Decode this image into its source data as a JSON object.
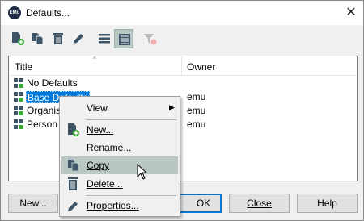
{
  "window": {
    "app_icon_text": "EMu",
    "title": "Defaults...",
    "close_glyph": "✕"
  },
  "toolbar": {
    "buttons": [
      {
        "name": "new-default-icon"
      },
      {
        "name": "copy-default-icon"
      },
      {
        "name": "delete-icon"
      },
      {
        "name": "edit-pencil-icon"
      },
      {
        "name": "list-view-icon"
      },
      {
        "name": "details-view-icon",
        "active": true
      },
      {
        "name": "clear-filter-icon",
        "disabled": true
      }
    ]
  },
  "list": {
    "columns": {
      "title": "Title",
      "owner": "Owner"
    },
    "sort_glyph": "^",
    "rows": [
      {
        "title": "No Defaults",
        "owner": ""
      },
      {
        "title": "Base Defaults",
        "owner": "emu",
        "selected": true
      },
      {
        "title": "Organisat",
        "owner": "emu"
      },
      {
        "title": "Person P",
        "owner": "emu"
      }
    ]
  },
  "buttons": {
    "new": "New...",
    "ok": "OK",
    "close": "Close",
    "help": "Help"
  },
  "context_menu": {
    "items": [
      {
        "label": "View",
        "submenu": true,
        "submenu_glyph": "▶"
      },
      {
        "label": "New...",
        "icon": "new-document-icon"
      },
      {
        "label": "Rename..."
      },
      {
        "label": "Copy",
        "icon": "copy-icon",
        "highlighted": true
      },
      {
        "label": "Delete...",
        "icon": "trash-icon"
      },
      {
        "label": "Properties...",
        "icon": "pencil-icon"
      }
    ]
  },
  "colors": {
    "selection": "#0078d7",
    "menu_highlight": "#b9c7c3",
    "icon_green": "#3aa935",
    "icon_dark": "#3d5566"
  }
}
